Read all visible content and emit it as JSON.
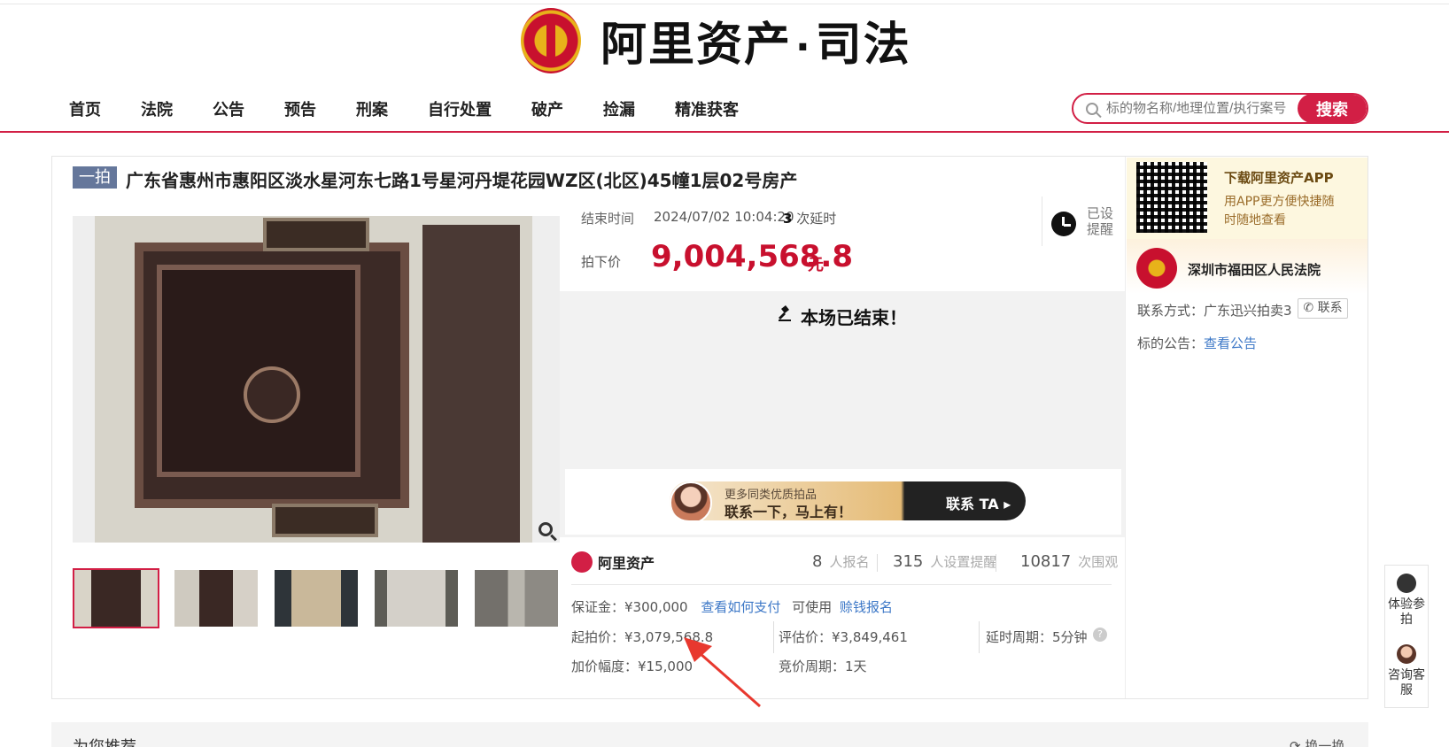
{
  "logo": {
    "brand": "阿里资产",
    "dot": "·",
    "sub": "司法"
  },
  "nav": [
    "首页",
    "法院",
    "公告",
    "预告",
    "刑案",
    "自行处置",
    "破产",
    "捡漏",
    "精准获客"
  ],
  "search": {
    "placeholder": "标的物名称/地理位置/执行案号",
    "button": "搜索"
  },
  "item": {
    "badge": "一拍",
    "title": "广东省惠州市惠阳区淡水星河东七路1号星河丹堤花园WZ区(北区)45幢1层02号房产",
    "end_label": "结束时间",
    "end_time": "2024/07/02 10:04:20",
    "delay_count": "3",
    "delay_text": "次延时",
    "price_label": "拍下价",
    "price": "9,004,568.8",
    "unit": "元",
    "alarm": "已设提醒",
    "ended_msg": "本场已结束！"
  },
  "banner": {
    "line1": "更多同类优质拍品",
    "line2": "联系一下，马上有！",
    "cta": "联系 TA ▸"
  },
  "stats": {
    "brand": "阿里资产",
    "signups": "8",
    "signups_label": "人报名",
    "reminders": "315",
    "reminders_label": "人设置提醒",
    "views": "10817",
    "views_label": "次围观"
  },
  "details": {
    "deposit": "保证金：¥300,000",
    "how_pay": "查看如何支付",
    "can_use": "可使用",
    "credit": "赊钱报名",
    "start_price": "起拍价：¥3,079,568.8",
    "eval_price": "评估价：¥3,849,461",
    "delay_period": "延时周期：5分钟",
    "increment": "加价幅度：¥15,000",
    "auction_period": "竞价周期：1天"
  },
  "sidebar": {
    "app_title": "下载阿里资产APP",
    "app_sub": "用APP更方便快捷随时随地查看",
    "court": "深圳市福田区人民法院",
    "contact_label": "联系方式：",
    "contact_value": "广东迅兴拍卖3",
    "contact_btn": "联系",
    "notice_label": "标的公告：",
    "notice_link": "查看公告"
  },
  "float": {
    "experience": "体验参拍",
    "service": "咨询客服"
  },
  "recommend": {
    "title": "为您推荐",
    "refresh": "换一换"
  },
  "colors": {
    "accent": "#d21f45",
    "price": "#c8102e",
    "link": "#3d78c7"
  }
}
